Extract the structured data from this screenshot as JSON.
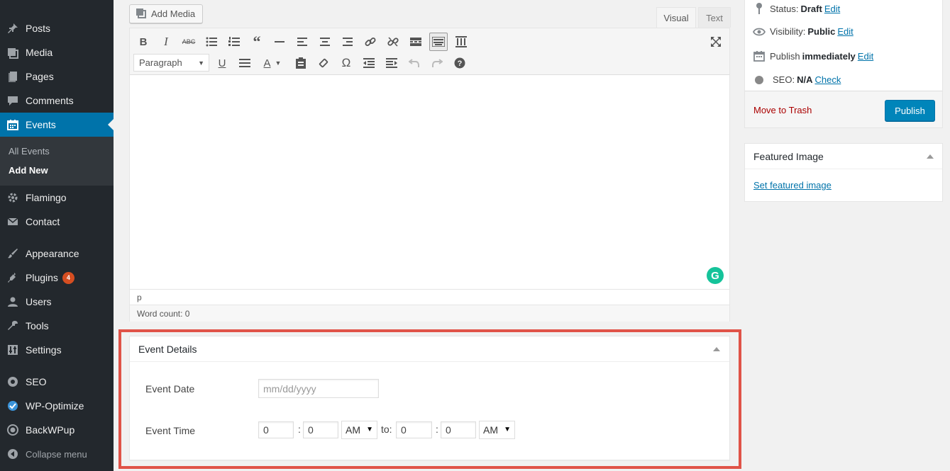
{
  "sidebar": {
    "items": [
      {
        "label": "Posts",
        "icon": "pushpin-icon"
      },
      {
        "label": "Media",
        "icon": "media-icon"
      },
      {
        "label": "Pages",
        "icon": "pages-icon"
      },
      {
        "label": "Comments",
        "icon": "comments-icon"
      },
      {
        "label": "Events",
        "icon": "calendar-icon",
        "active": true
      },
      {
        "label": "Flamingo",
        "icon": "gear-icon"
      },
      {
        "label": "Contact",
        "icon": "mail-icon"
      },
      {
        "label": "Appearance",
        "icon": "brush-icon"
      },
      {
        "label": "Plugins",
        "icon": "plugin-icon",
        "badge": "4"
      },
      {
        "label": "Users",
        "icon": "user-icon"
      },
      {
        "label": "Tools",
        "icon": "wrench-icon"
      },
      {
        "label": "Settings",
        "icon": "settings-icon"
      },
      {
        "label": "SEO",
        "icon": "seo-icon"
      },
      {
        "label": "WP-Optimize",
        "icon": "check-circle-icon"
      },
      {
        "label": "BackWPup",
        "icon": "backwpup-icon"
      }
    ],
    "submenu": [
      "All Events",
      "Add New"
    ],
    "collapse_label": "Collapse menu"
  },
  "editor": {
    "add_media_label": "Add Media",
    "tabs": [
      "Visual",
      "Text"
    ],
    "format_select": "Paragraph",
    "path": "p",
    "word_count": "Word count: 0",
    "grammarly_letter": "G"
  },
  "event_details": {
    "title": "Event Details",
    "date_label": "Event Date",
    "date_placeholder": "mm/dd/yyyy",
    "time_label": "Event Time",
    "start_hour": "0",
    "start_minute": "0",
    "start_ampm": "AM",
    "to_label": "to:",
    "end_hour": "0",
    "end_minute": "0",
    "end_ampm": "AM",
    "colon": ":"
  },
  "publish": {
    "status_label": "Status:",
    "status_value": "Draft",
    "visibility_label": "Visibility:",
    "visibility_value": "Public",
    "publish_label": "Publish",
    "publish_value": "immediately",
    "seo_label": "SEO:",
    "seo_value": "N/A",
    "seo_link": "Check",
    "edit_link": "Edit",
    "trash_label": "Move to Trash",
    "publish_button": "Publish"
  },
  "featured_image": {
    "title": "Featured Image",
    "link": "Set featured image"
  },
  "colors": {
    "sidebar_bg": "#23282d",
    "active_bg": "#0073aa",
    "highlight": "#e05348",
    "publish_button": "#0085ba"
  }
}
